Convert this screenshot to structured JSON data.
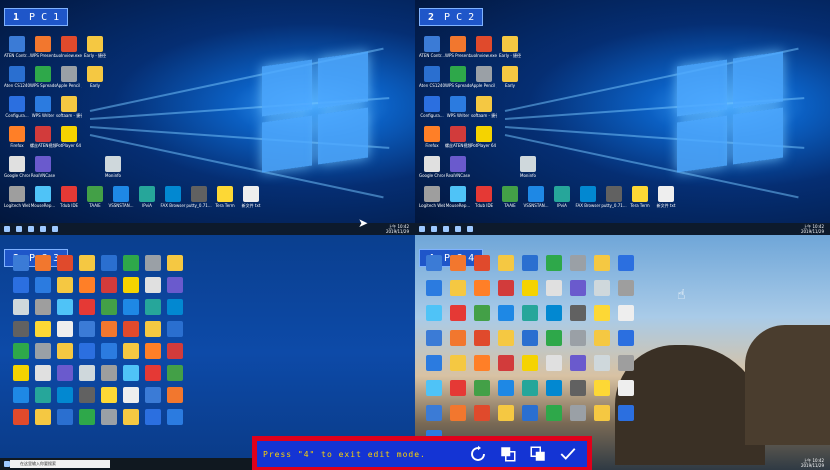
{
  "quadrants": [
    {
      "index": "1",
      "label": "P C 1",
      "taskbar_time": "上午 10:42",
      "taskbar_date": "2019/11/29"
    },
    {
      "index": "2",
      "label": "P C 2",
      "taskbar_time": "上午 10:42",
      "taskbar_date": "2019/11/29"
    },
    {
      "index": "3",
      "label": "P C 3",
      "search_placeholder": "在这里输入你要搜索"
    },
    {
      "index": "4",
      "label": "P C 4",
      "taskbar_time": "上午 10:42",
      "taskbar_date": "2019/11/29"
    }
  ],
  "desktop_icons_pc1": [
    {
      "label": "ATEN Contr...",
      "color": "#3b7bd6"
    },
    {
      "label": "WPS Presentation",
      "color": "#f2772e"
    },
    {
      "label": "uoInview.exe",
      "color": "#e04a2c"
    },
    {
      "label": "Early - 捷径",
      "color": "#f5c842"
    },
    {
      "label": "Aten CS1240...",
      "color": "#2a6fd0"
    },
    {
      "label": "WPS Spreadshe...",
      "color": "#2ea84a"
    },
    {
      "label": "Apple Pencil 主机厂 - 捷",
      "color": "#9aa0a6"
    },
    {
      "label": "Early",
      "color": "#f5c842"
    },
    {
      "label": "Configura...",
      "color": "#2b6fe0"
    },
    {
      "label": "WPS Writer",
      "color": "#2b7be0"
    },
    {
      "label": "softaam - 捷径",
      "color": "#f5c842"
    },
    {
      "label": "Firefox",
      "color": "#ff7f27"
    },
    {
      "label": "螺丝ATEN视频",
      "color": "#d23b3b"
    },
    {
      "label": "PotPlayer 64 bit",
      "color": "#f5d300"
    },
    {
      "label": "Google Chrome",
      "color": "#e0e0e0"
    },
    {
      "label": "RealVNCase",
      "color": "#6a5acd"
    },
    {
      "label": "Moninfo",
      "color": "#cfd8dc"
    },
    {
      "label": "Logitech Webca...",
      "color": "#9e9e9e"
    },
    {
      "label": "MouseRep...",
      "color": "#4fc3f7"
    },
    {
      "label": "Tdub IDE",
      "color": "#e53935"
    },
    {
      "label": "TAAIE",
      "color": "#43a047"
    },
    {
      "label": "VSSNSTAN...",
      "color": "#1e88e5"
    },
    {
      "label": "IPviA",
      "color": "#26a69a"
    },
    {
      "label": "FAX Browser",
      "color": "#0288d1"
    },
    {
      "label": "putty_0.71...",
      "color": "#616161"
    },
    {
      "label": "Tera Term",
      "color": "#fdd835"
    },
    {
      "label": "新文件 txt",
      "color": "#eeeeee"
    }
  ],
  "exit_bar": {
    "message": "Press \"4\" to exit edit mode.",
    "refresh_icon": "refresh-icon",
    "copy_icon": "copy-icon",
    "paste_icon": "paste-icon",
    "confirm_icon": "check-icon"
  }
}
